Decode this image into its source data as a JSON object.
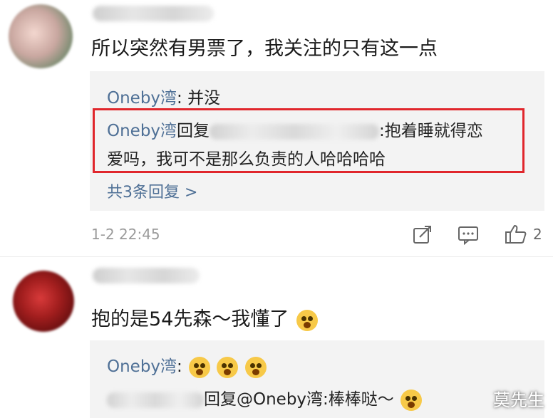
{
  "comment1": {
    "text": "所以突然有男票了，我关注的只有这一点",
    "replies": {
      "line1_nick": "Oneby湾",
      "line1_text": ": 并没",
      "highlight_nick": "Oneby湾",
      "highlight_reply": "回复",
      "highlight_text_a": ":抱着睡就得恋",
      "highlight_text_b": "爱吗，我可不是那么负责的人哈哈哈哈",
      "more": "共3条回复 >"
    },
    "time": "1-2 22:45",
    "like_count": "2"
  },
  "comment2": {
    "text": "抱的是54先森～我懂了",
    "replies": {
      "line1_nick": "Oneby湾",
      "line1_text": ":",
      "line2_text": "回复@Oneby湾:棒棒哒～"
    }
  },
  "icons": [
    "forward-icon",
    "comment-icon",
    "like-icon"
  ],
  "watermark": "莫先生"
}
